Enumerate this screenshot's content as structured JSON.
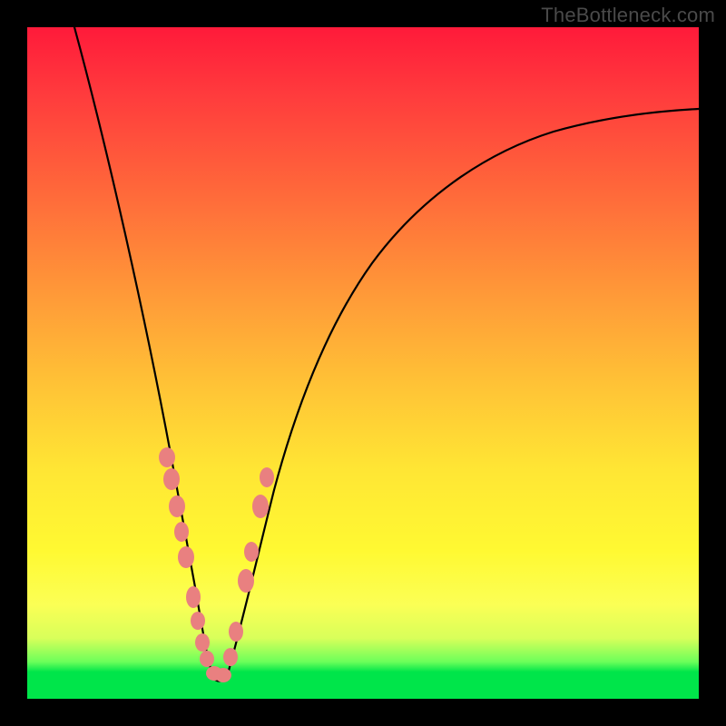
{
  "watermark": "TheBottleneck.com",
  "colors": {
    "frame": "#000000",
    "curve": "#000000",
    "marker": "#e98080",
    "gradient_stops": [
      "#ff1a3a",
      "#ff6a3a",
      "#ffc236",
      "#fff932",
      "#6cff5a",
      "#00e54a"
    ]
  },
  "chart_data": {
    "type": "line",
    "title": "",
    "xlabel": "",
    "ylabel": "",
    "xlim": [
      0,
      100
    ],
    "ylim": [
      0,
      100
    ],
    "note": "Axes are unlabeled. x and y read as percent of plot width/height with y=0 at the bottom. Curve is a V-shaped bottleneck profile with minimum near x≈27, y≈3. Right branch rises asymptotically toward ~87.",
    "series": [
      {
        "name": "bottleneck-curve",
        "x": [
          7,
          10,
          14,
          18,
          21,
          23,
          25,
          27,
          29,
          31,
          33,
          36,
          40,
          46,
          54,
          64,
          76,
          90,
          100
        ],
        "y": [
          100,
          88,
          72,
          55,
          42,
          30,
          16,
          3,
          10,
          20,
          30,
          40,
          50,
          60,
          68,
          75,
          81,
          85,
          87
        ]
      }
    ],
    "markers": {
      "name": "highlighted-points",
      "note": "Salmon-colored overlapping dots clustered along both branches in the lower ~35% of the plot (yellow/green band).",
      "points": [
        {
          "x": 20.5,
          "y": 36
        },
        {
          "x": 21.3,
          "y": 32
        },
        {
          "x": 22.1,
          "y": 27
        },
        {
          "x": 22.8,
          "y": 24
        },
        {
          "x": 23.5,
          "y": 20
        },
        {
          "x": 24.6,
          "y": 14
        },
        {
          "x": 25.2,
          "y": 11
        },
        {
          "x": 25.9,
          "y": 8
        },
        {
          "x": 26.5,
          "y": 6
        },
        {
          "x": 27.5,
          "y": 4
        },
        {
          "x": 28.5,
          "y": 4.5
        },
        {
          "x": 29.5,
          "y": 7
        },
        {
          "x": 30.2,
          "y": 11
        },
        {
          "x": 31.7,
          "y": 19
        },
        {
          "x": 32.5,
          "y": 23
        },
        {
          "x": 33.8,
          "y": 30
        },
        {
          "x": 34.6,
          "y": 34
        }
      ]
    }
  }
}
